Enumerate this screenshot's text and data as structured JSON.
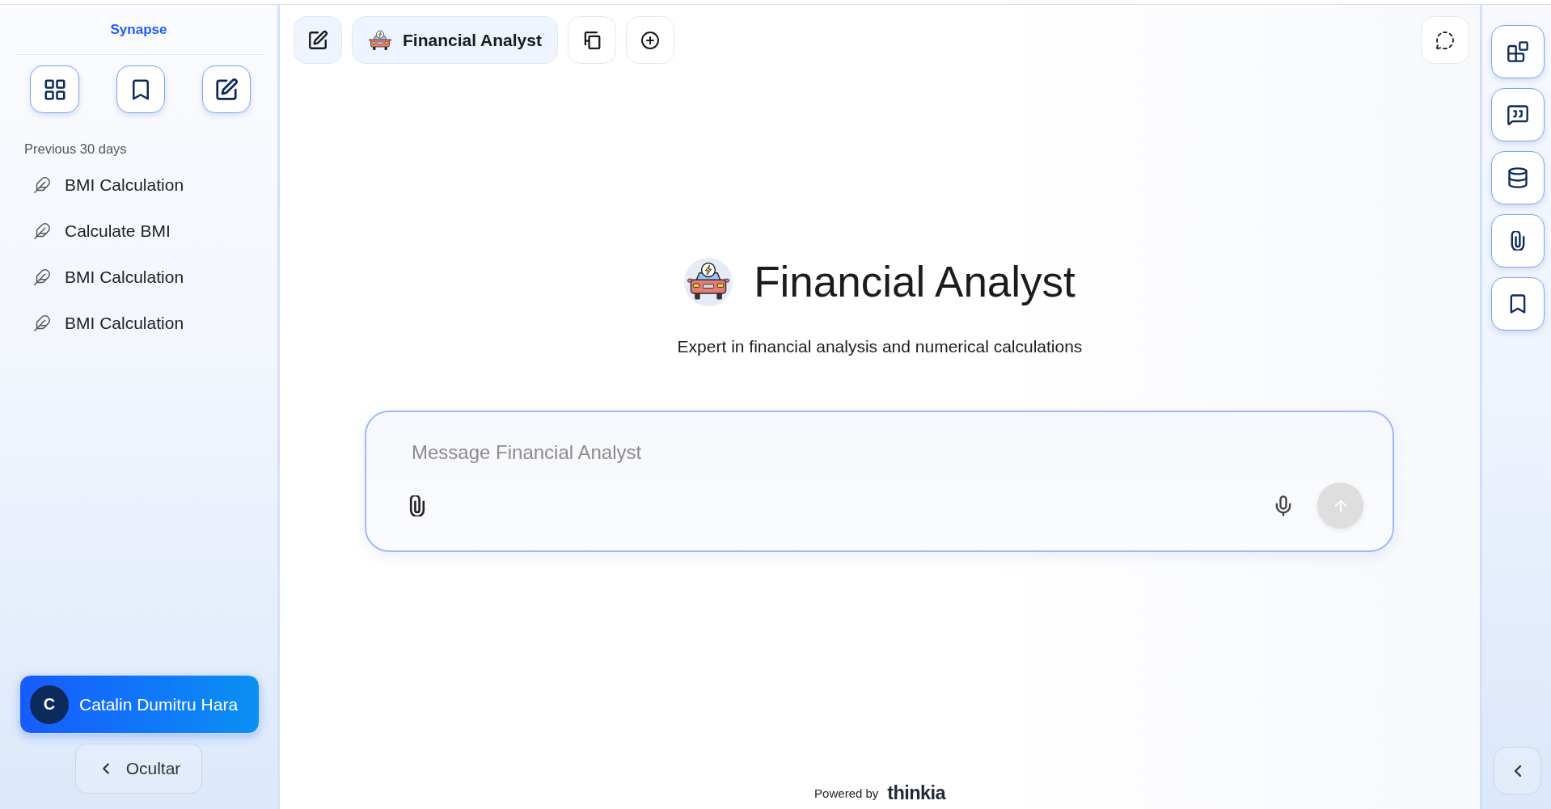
{
  "sidebar": {
    "brand": "Synapse",
    "section_label": "Previous 30 days",
    "chats": [
      {
        "title": "BMI Calculation"
      },
      {
        "title": "Calculate BMI"
      },
      {
        "title": "BMI Calculation"
      },
      {
        "title": "BMI Calculation"
      }
    ],
    "user": {
      "initial": "C",
      "name": "Catalin Dumitru Hara"
    },
    "hide_label": "Ocultar"
  },
  "toolbar": {
    "agent_label": "Financial Analyst"
  },
  "agent": {
    "name": "Financial Analyst",
    "description": "Expert in financial analysis and numerical calculations"
  },
  "composer": {
    "placeholder": "Message Financial Analyst",
    "send_button": {
      "disabled": true
    }
  },
  "footer": {
    "powered_by": "Powered by",
    "logo": "thinkia"
  }
}
